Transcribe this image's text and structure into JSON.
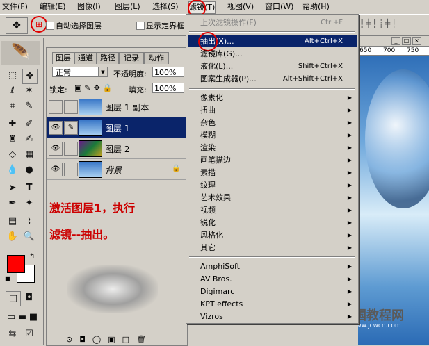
{
  "menubar": {
    "items": [
      "文件(F)",
      "编辑(E)",
      "图像(I)",
      "图层(L)",
      "选择(S)",
      "滤镜(T)",
      "视图(V)",
      "窗口(W)",
      "帮助(H)"
    ]
  },
  "options": {
    "auto_select": "自动选择图层",
    "show_bounds": "显示定界框"
  },
  "layers_panel": {
    "tabs": [
      "图层",
      "通道",
      "路径",
      "记录",
      "动作"
    ],
    "blend_mode": "正常",
    "opacity_label": "不透明度:",
    "opacity_value": "100%",
    "lock_label": "锁定:",
    "fill_label": "填充:",
    "fill_value": "100%",
    "layers": [
      {
        "name": "图层 1 副本"
      },
      {
        "name": "图层 1"
      },
      {
        "name": "图层 2"
      },
      {
        "name": "背景"
      }
    ]
  },
  "annotation": {
    "line1": "激活图层1，执行",
    "line2": "滤镜--抽出。"
  },
  "filter_menu": {
    "last_filter": "上次滤镜操作(F)",
    "last_filter_shortcut": "Ctrl+F",
    "extract": "抽出(X)...",
    "extract_shortcut": "Alt+Ctrl+X",
    "filter_gallery": "滤镜库(G)...",
    "liquify": "液化(L)...",
    "liquify_shortcut": "Shift+Ctrl+X",
    "pattern_maker": "图案生成器(P)...",
    "pattern_maker_shortcut": "Alt+Shift+Ctrl+X",
    "submenus": [
      "像素化",
      "扭曲",
      "杂色",
      "模糊",
      "渲染",
      "画笔描边",
      "素描",
      "纹理",
      "艺术效果",
      "视频",
      "锐化",
      "风格化",
      "其它"
    ],
    "plugins": [
      "AmphiSoft",
      "AV Bros.",
      "Digimarc",
      "KPT effects",
      "Vizros"
    ]
  },
  "canvas": {
    "ruler_labels": [
      "650",
      "700",
      "750"
    ],
    "watermark": "中国教程网",
    "watermark_url": "www.jcwcn.com"
  },
  "colors": {
    "highlight": "#0a246a",
    "foreground": "#ff0000",
    "annotation": "#cc0000"
  }
}
